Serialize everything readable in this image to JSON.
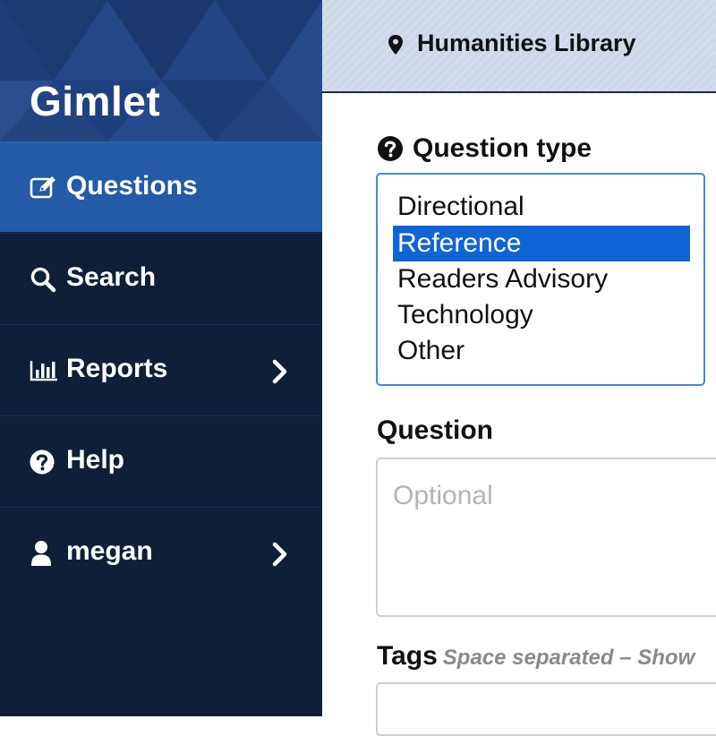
{
  "sidebar": {
    "brand": "Gimlet",
    "items": [
      {
        "label": "Questions",
        "icon": "edit-icon",
        "active": true
      },
      {
        "label": "Search",
        "icon": "search-icon"
      },
      {
        "label": "Reports",
        "icon": "bar-chart-icon",
        "has_submenu": true
      },
      {
        "label": "Help",
        "icon": "question-circle-icon"
      },
      {
        "label": "megan",
        "icon": "user-icon",
        "has_submenu": true
      }
    ]
  },
  "header": {
    "location": "Humanities Library",
    "icon": "map-pin-icon"
  },
  "form": {
    "question_type": {
      "label": "Question type",
      "icon": "question-circle-icon",
      "options": [
        "Directional",
        "Reference",
        "Readers Advisory",
        "Technology",
        "Other"
      ],
      "selected": "Reference"
    },
    "question": {
      "label": "Question",
      "placeholder": "Optional"
    },
    "tags": {
      "label": "Tags",
      "hint": "Space separated – Show"
    }
  },
  "colors": {
    "sidebar_bg": "#0f1f3a",
    "active_item": "#245aa6",
    "brand_bg": "#1e3f78",
    "selection": "#1164d6",
    "header_bg": "#cdd7e8"
  }
}
